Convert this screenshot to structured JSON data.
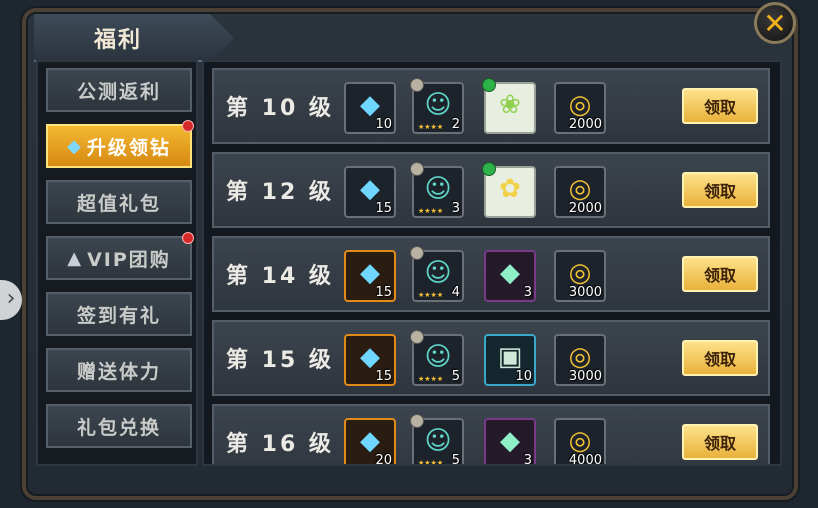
{
  "window": {
    "title": "福利"
  },
  "close_icon": "✕",
  "side_arrow_icon": "›",
  "sidebar": {
    "items": [
      {
        "label": "公测返利",
        "active": false,
        "dot": false,
        "icon": ""
      },
      {
        "label": "升级领钻",
        "active": true,
        "dot": true,
        "icon": "diamond-icon"
      },
      {
        "label": "超值礼包",
        "active": false,
        "dot": false,
        "icon": ""
      },
      {
        "label": "VIP团购",
        "active": false,
        "dot": true,
        "icon": "helmet-icon"
      },
      {
        "label": "签到有礼",
        "active": false,
        "dot": false,
        "icon": ""
      },
      {
        "label": "赠送体力",
        "active": false,
        "dot": false,
        "icon": ""
      },
      {
        "label": "礼包兑换",
        "active": false,
        "dot": false,
        "icon": ""
      }
    ]
  },
  "rewards": {
    "rows": [
      {
        "level": "第 10 级",
        "diamonds": "10",
        "hero": "2",
        "third": {
          "type": "pet",
          "qty": ""
        },
        "gold": "2000",
        "claim": "领取"
      },
      {
        "level": "第 12 级",
        "diamonds": "15",
        "hero": "3",
        "third": {
          "type": "pet-flower",
          "qty": ""
        },
        "gold": "2000",
        "claim": "领取"
      },
      {
        "level": "第 14 级",
        "diamonds": "15",
        "hero": "4",
        "third": {
          "type": "crystal",
          "qty": "3"
        },
        "gold": "3000",
        "claim": "领取"
      },
      {
        "level": "第 15 级",
        "diamonds": "15",
        "hero": "5",
        "third": {
          "type": "scroll",
          "qty": "10"
        },
        "gold": "3000",
        "claim": "领取"
      },
      {
        "level": "第 16 级",
        "diamonds": "20",
        "hero": "5",
        "third": {
          "type": "crystal",
          "qty": "3"
        },
        "gold": "4000",
        "claim": "领取"
      }
    ]
  },
  "colors": {
    "accent": "#f2b21a",
    "claim_button": "#f0c04a",
    "active_tab": "#e9a321"
  }
}
